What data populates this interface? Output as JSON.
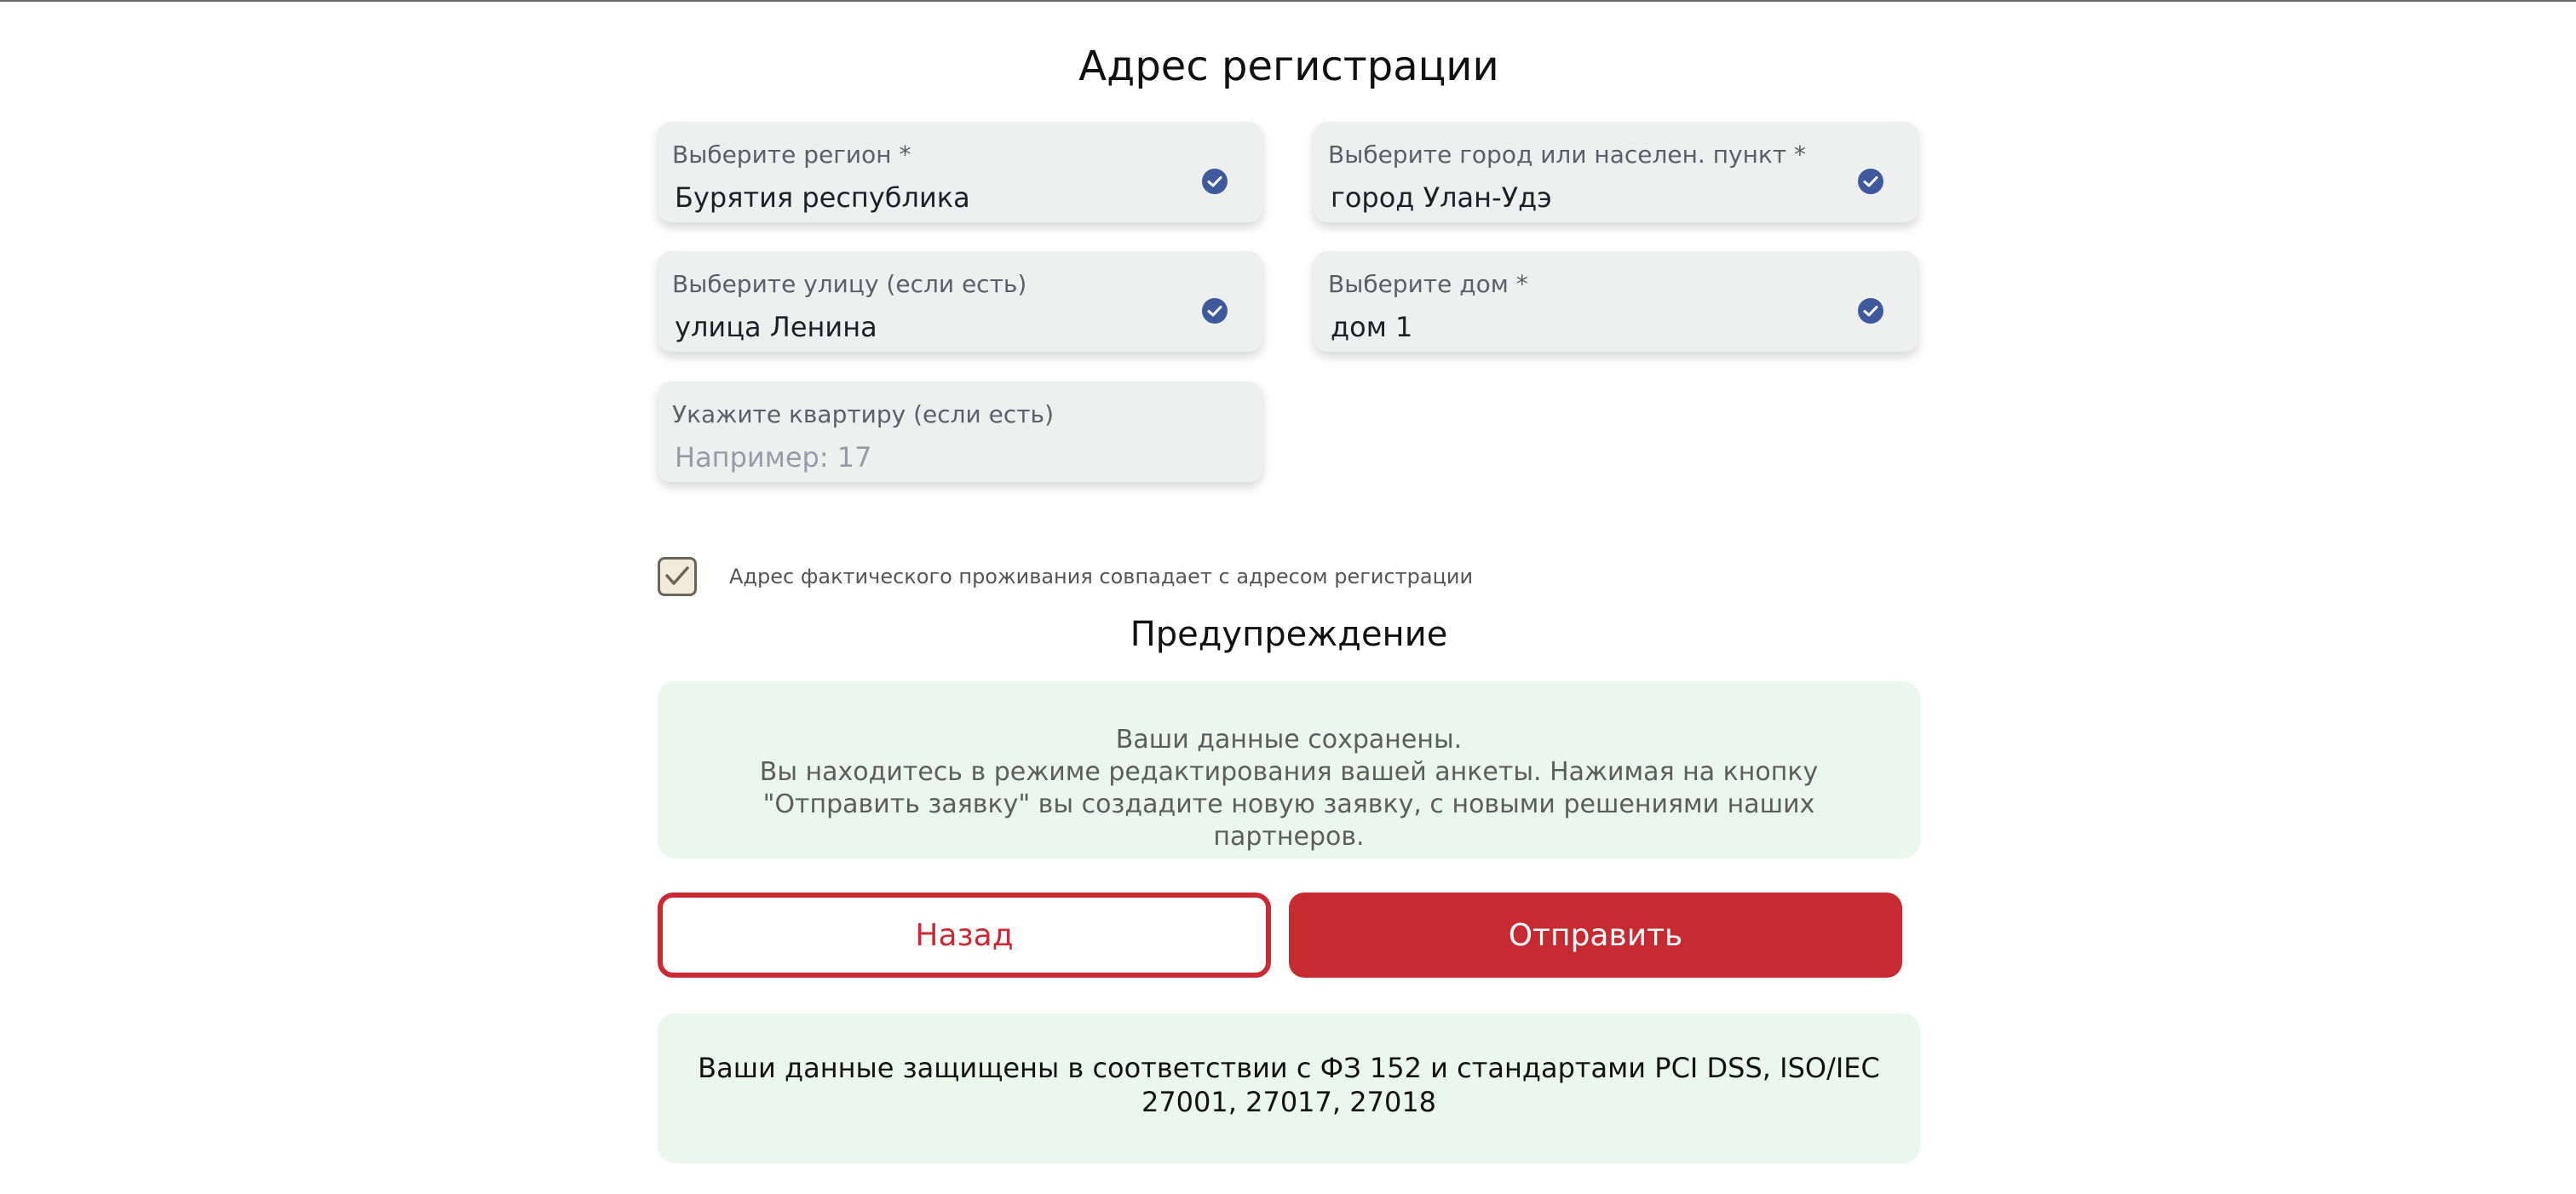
{
  "registration": {
    "title": "Адрес регистрации",
    "region": {
      "label": "Выберите регион *",
      "value": "Бурятия республика"
    },
    "city": {
      "label": "Выберите город или населен. пункт *",
      "value": "город Улан-Удэ"
    },
    "street": {
      "label": "Выберите улицу (если есть)",
      "value": "улица Ленина"
    },
    "house": {
      "label": "Выберите дом *",
      "value": "дом 1"
    },
    "flat": {
      "label": "Укажите квартиру (если есть)",
      "placeholder": "Например: 17",
      "value": ""
    }
  },
  "same_address": {
    "checked": true,
    "label": "Адрес фактического проживания совпадает с адресом регистрации"
  },
  "warning": {
    "title": "Предупреждение",
    "line1": "Ваши данные сохранены.",
    "line2": "Вы находитесь в режиме редактирования вашей анкеты. Нажимая на кнопку \"Отправить заявку\" вы создадите новую заявку, с новыми решениями наших партнеров."
  },
  "buttons": {
    "back": "Назад",
    "send": "Отправить"
  },
  "security_notice": "Ваши данные защищены в соответствии с ФЗ 152 и стандартами PCI DSS, ISO/IEC 27001, 27017, 27018",
  "colors": {
    "accent_red": "#c62b31",
    "check_blue": "#3f5a9c",
    "notice_bg": "#eaf7ec",
    "field_bg": "#eef0f0"
  },
  "icons": {
    "field_valid": "check-circle-icon",
    "agree": "checkmark-icon"
  }
}
